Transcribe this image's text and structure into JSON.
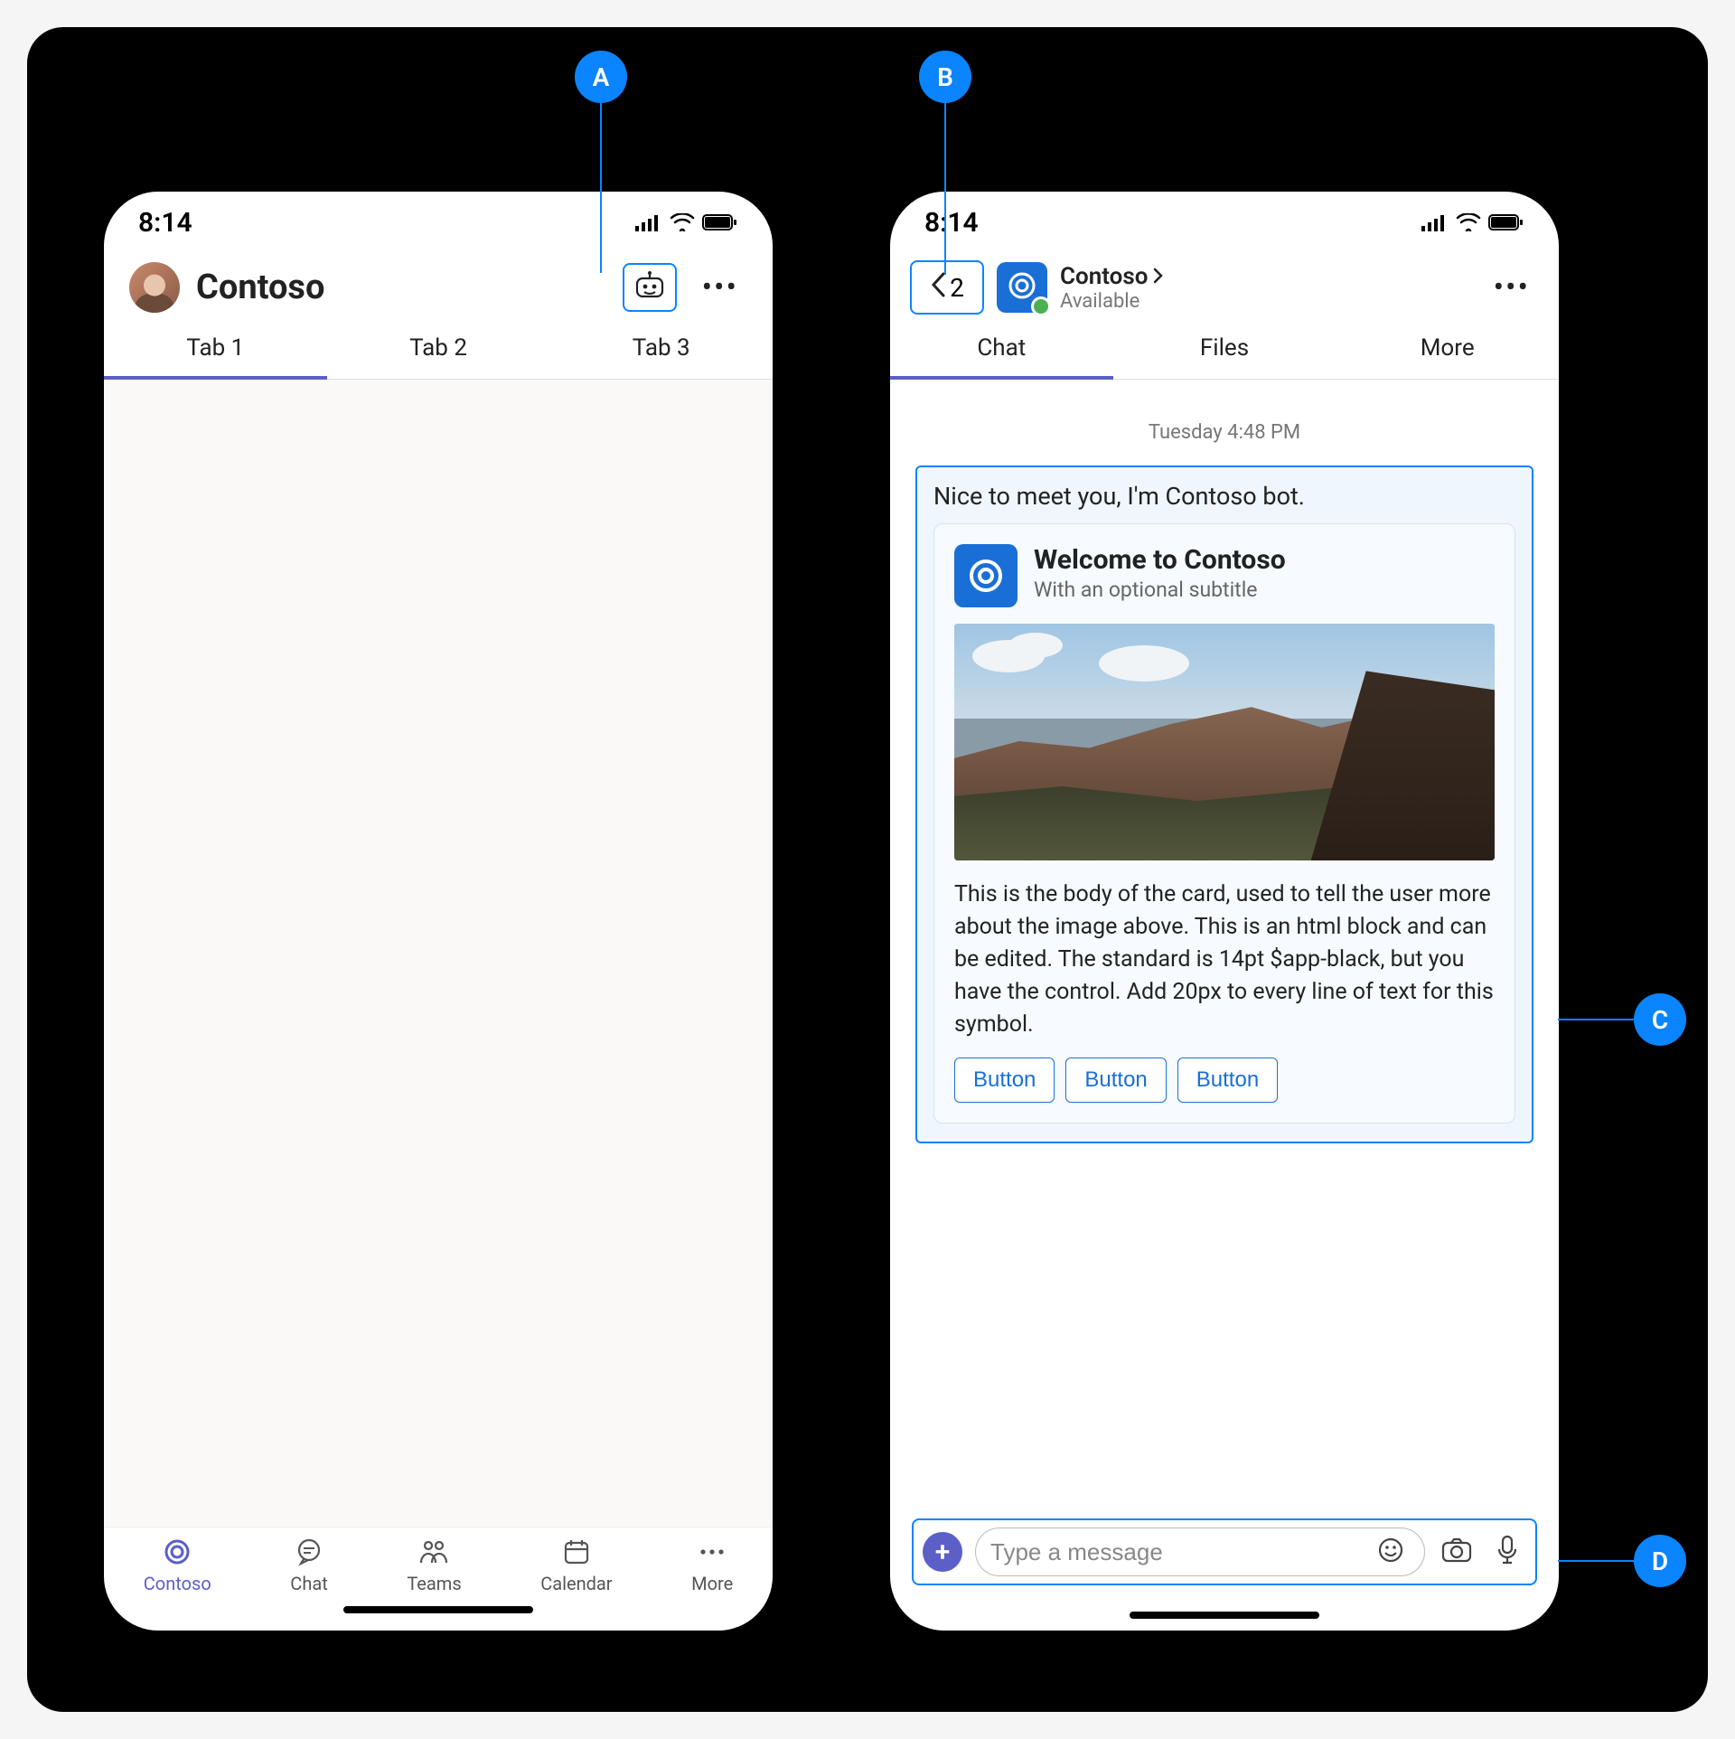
{
  "callouts": {
    "a": "A",
    "b": "B",
    "c": "C",
    "d": "D"
  },
  "phone_a": {
    "status_time": "8:14",
    "title": "Contoso",
    "tabs": [
      "Tab 1",
      "Tab 2",
      "Tab 3"
    ],
    "nav": {
      "contoso": "Contoso",
      "chat": "Chat",
      "teams": "Teams",
      "calendar": "Calendar",
      "more": "More"
    }
  },
  "phone_b": {
    "status_time": "8:14",
    "back_count": "2",
    "header_title": "Contoso",
    "header_status": "Available",
    "tabs": [
      "Chat",
      "Files",
      "More"
    ],
    "timestamp": "Tuesday 4:48 PM",
    "message_text": "Nice to meet you, I'm Contoso bot.",
    "card": {
      "title": "Welcome to Contoso",
      "subtitle": "With an optional subtitle",
      "body": "This is the body of the card, used to tell the user more about the image above. This is an html block and can be edited. The standard is 14pt $app-black, but you have the control. Add 20px to every line of text for this symbol.",
      "buttons": [
        "Button",
        "Button",
        "Button"
      ]
    },
    "compose_placeholder": "Type a message"
  }
}
